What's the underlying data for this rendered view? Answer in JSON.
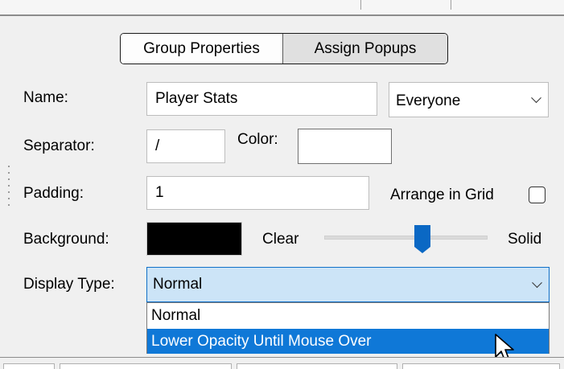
{
  "tabs": {
    "group_properties": "Group Properties",
    "assign_popups": "Assign Popups"
  },
  "form": {
    "name_label": "Name:",
    "name_value": "Player Stats",
    "visibility_value": "Everyone",
    "separator_label": "Separator:",
    "separator_value": "/",
    "color_label": "Color:",
    "padding_label": "Padding:",
    "padding_value": "1",
    "arrange_grid_label": "Arrange in Grid",
    "arrange_grid_checked": false,
    "background_label": "Background:",
    "background_color": "#000000",
    "opacity_min_label": "Clear",
    "opacity_max_label": "Solid",
    "opacity_level": 0.6,
    "display_type_label": "Display Type:",
    "display_type_value": "Normal"
  },
  "display_type_options": [
    "Normal",
    "Lower Opacity Until Mouse Over"
  ],
  "display_type_highlighted_index": 1,
  "colors": {
    "accent": "#0f78d7",
    "combo_focus": "#cce4f7",
    "slider_thumb": "#0a68c4"
  }
}
